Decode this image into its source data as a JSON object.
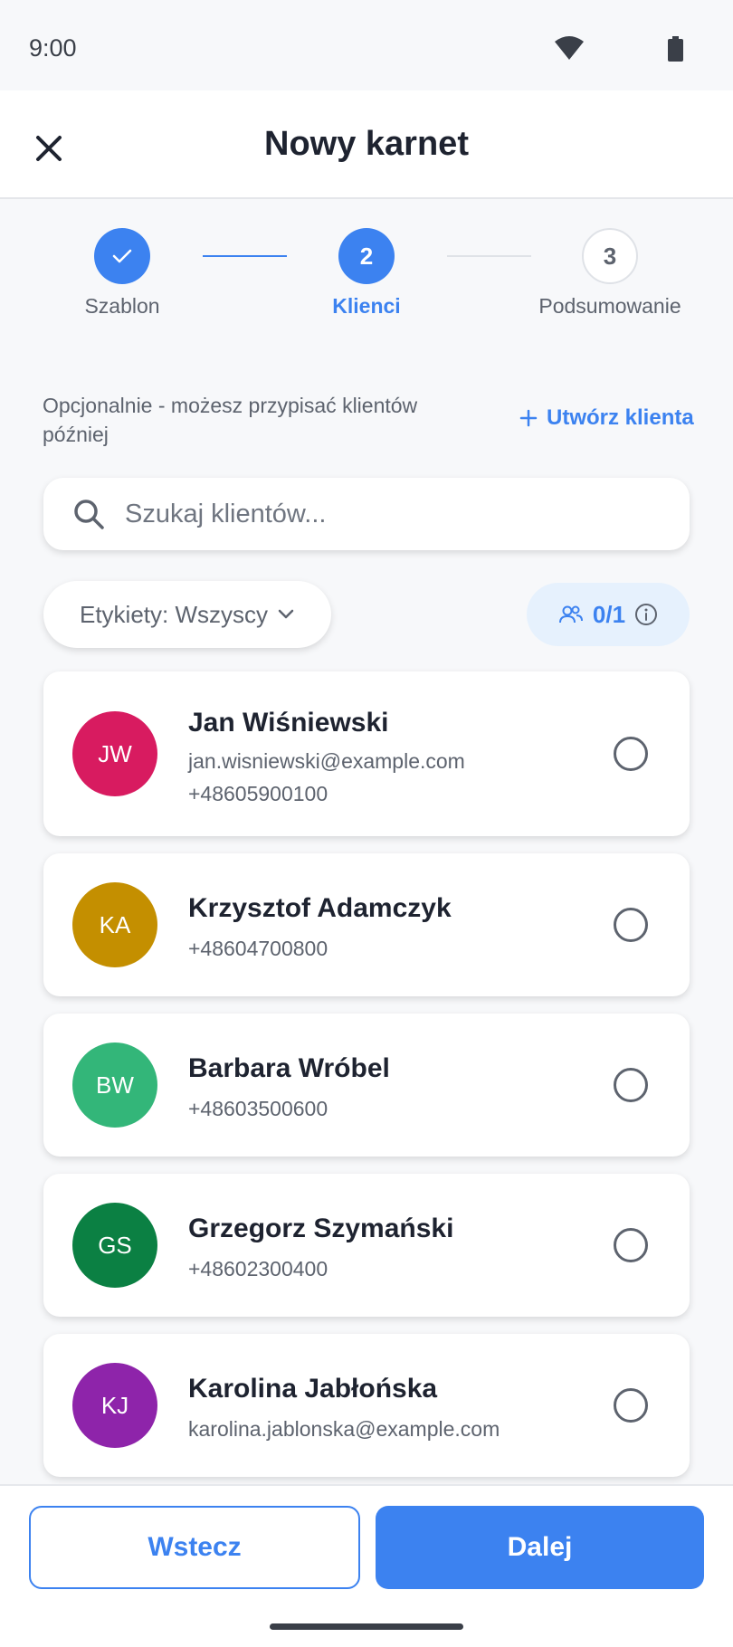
{
  "status_bar": {
    "time": "9:00"
  },
  "header": {
    "title": "Nowy karnet"
  },
  "stepper": {
    "steps": [
      {
        "label": "Szablon",
        "number": "",
        "state": "done"
      },
      {
        "label": "Klienci",
        "number": "2",
        "state": "active"
      },
      {
        "label": "Podsumowanie",
        "number": "3",
        "state": "upcoming"
      }
    ]
  },
  "hint": {
    "text": "Opcjonalnie - możesz przypisać klientów później"
  },
  "create_client": {
    "label": "Utwórz klienta"
  },
  "search": {
    "placeholder": "Szukaj klientów..."
  },
  "filter": {
    "label": "Etykiety: Wszyscy"
  },
  "selection": {
    "count": "0/1"
  },
  "clients": [
    {
      "initials": "JW",
      "name": "Jan Wiśniewski",
      "email": "jan.wisniewski@example.com",
      "phone": "+48605900100",
      "color": "#d81b60",
      "selected": false
    },
    {
      "initials": "KA",
      "name": "Krzysztof Adamczyk",
      "email": "",
      "phone": "+48604700800",
      "color": "#c48f00",
      "selected": false
    },
    {
      "initials": "BW",
      "name": "Barbara Wróbel",
      "email": "",
      "phone": "+48603500600",
      "color": "#33b679",
      "selected": false
    },
    {
      "initials": "GS",
      "name": "Grzegorz Szymański",
      "email": "",
      "phone": "+48602300400",
      "color": "#0b8043",
      "selected": false
    },
    {
      "initials": "KJ",
      "name": "Karolina Jabłońska",
      "email": "karolina.jablonska@example.com",
      "phone": "",
      "color": "#8e24aa",
      "selected": false
    }
  ],
  "footer": {
    "back_label": "Wstecz",
    "next_label": "Dalej"
  },
  "colors": {
    "primary": "#3c82f0",
    "text": "#1e2330",
    "muted": "#5d636e"
  }
}
